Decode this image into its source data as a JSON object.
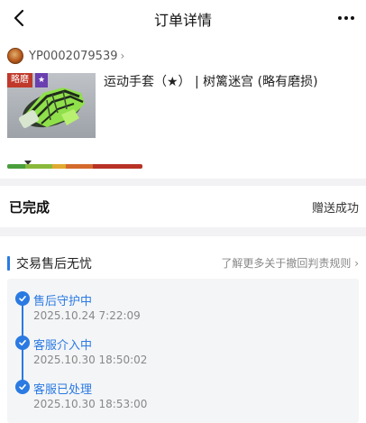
{
  "header": {
    "title": "订单详情",
    "back_icon": "chevron-left-icon",
    "more_icon": "ellipsis-icon"
  },
  "seller": {
    "id": "YP0002079539",
    "chevron": "›"
  },
  "item": {
    "name": "运动手套（★） | 树篱迷宫 (略有磨损)",
    "wear_tag": "略磨",
    "star_tag": "★"
  },
  "status": {
    "label": "已完成",
    "value": "赠送成功"
  },
  "guarantee": {
    "title": "交易售后无忧",
    "link": "了解更多关于撤回判责规则 ›",
    "steps": [
      {
        "title": "售后守护中",
        "time": "2025.10.24 7:22:09"
      },
      {
        "title": "客服介入中",
        "time": "2025.10.30 18:50:02"
      },
      {
        "title": "客服已处理",
        "time": "2025.10.30 18:53:00"
      }
    ]
  },
  "colors": {
    "accent": "#2a7ae2",
    "wear_tag_bg": "#c0392b",
    "star_tag_bg": "#6a3fb0"
  }
}
